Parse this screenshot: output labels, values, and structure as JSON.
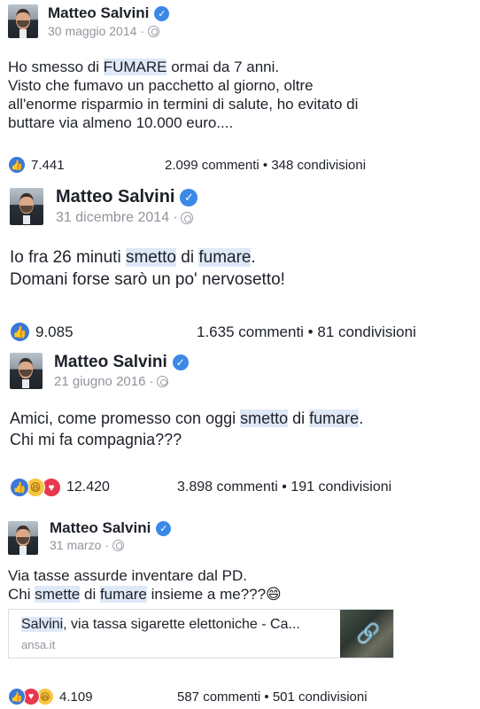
{
  "posts": [
    {
      "author": "Matteo Salvini",
      "date": "30 maggio 2014",
      "text_lines": [
        [
          {
            "t": "Ho smesso di "
          },
          {
            "t": "FUMARE",
            "hl": true
          },
          {
            "t": " ormai da 7 anni."
          }
        ],
        [
          {
            "t": "Visto che fumavo un pacchetto al giorno, oltre"
          }
        ],
        [
          {
            "t": "all'enorme risparmio in termini di salute, ho evitato di"
          }
        ],
        [
          {
            "t": "buttare via almeno 10.000 euro...."
          }
        ]
      ],
      "reactions": [
        "like-icon"
      ],
      "reaction_count": "7.441",
      "comments": "2.099 commenti",
      "shares": "348 condivisioni"
    },
    {
      "author": "Matteo Salvini",
      "date": "31 dicembre 2014",
      "text_lines": [
        [
          {
            "t": "Io fra 26 minuti "
          },
          {
            "t": "smetto",
            "hl": true
          },
          {
            "t": " di "
          },
          {
            "t": "fumare",
            "hl": true
          },
          {
            "t": "."
          }
        ],
        [
          {
            "t": "Domani forse sarò un po' nervosetto!"
          }
        ]
      ],
      "reactions": [
        "like-icon"
      ],
      "reaction_count": "9.085",
      "comments": "1.635 commenti",
      "shares": "81 condivisioni"
    },
    {
      "author": "Matteo Salvini",
      "date": "21 giugno 2016",
      "text_lines": [
        [
          {
            "t": "Amici, come promesso con oggi "
          },
          {
            "t": "smetto",
            "hl": true
          },
          {
            "t": " di "
          },
          {
            "t": "fumare",
            "hl": true
          },
          {
            "t": "."
          }
        ],
        [
          {
            "t": "Chi mi fa compagnia???"
          }
        ]
      ],
      "reactions": [
        "like-icon",
        "haha-icon",
        "love-icon"
      ],
      "reaction_count": "12.420",
      "comments": "3.898 commenti",
      "shares": "191 condivisioni"
    },
    {
      "author": "Matteo Salvini",
      "date": "31 marzo",
      "text_lines": [
        [
          {
            "t": "Via tasse assurde inventare dal PD."
          }
        ],
        [
          {
            "t": "Chi "
          },
          {
            "t": "smette",
            "hl": true
          },
          {
            "t": " di "
          },
          {
            "t": "fumare",
            "hl": true
          },
          {
            "t": " insieme a me???😄"
          }
        ]
      ],
      "link": {
        "title_parts": [
          {
            "t": "Salvini",
            "hl": true
          },
          {
            "t": ", via tassa sigarette elettoniche - Ca..."
          }
        ],
        "domain": "ansa.it"
      },
      "reactions": [
        "like-icon",
        "love-icon",
        "haha-icon"
      ],
      "reaction_count": "4.109",
      "comments": "587 commenti",
      "shares": "501 condivisioni"
    }
  ],
  "separator": " • ",
  "verified_glyph": "✓",
  "colors": {
    "highlight": "#dfe8f6",
    "like": "#3b78d8",
    "love": "#e8384f",
    "haha": "#f7c541",
    "verified": "#3b88e7",
    "meta_gray": "#90949c"
  }
}
